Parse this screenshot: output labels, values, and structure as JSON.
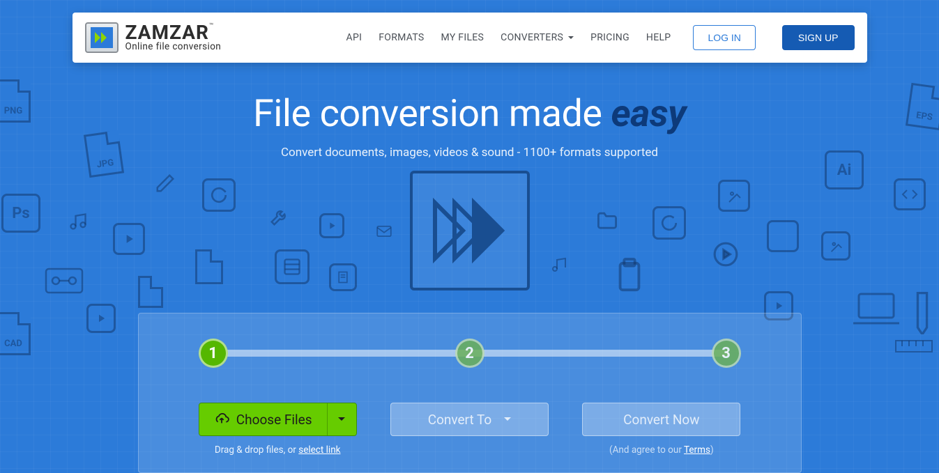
{
  "brand": {
    "name": "ZAMZAR",
    "trademark": "™",
    "tagline": "Online file conversion"
  },
  "nav": {
    "api": "API",
    "formats": "FORMATS",
    "myfiles": "MY FILES",
    "converters": "CONVERTERS",
    "pricing": "PRICING",
    "help": "HELP",
    "login": "LOG IN",
    "signup": "SIGN UP"
  },
  "hero": {
    "title_prefix": "File conversion made ",
    "title_emphasis": "easy",
    "subtitle": "Convert documents, images, videos & sound - 1100+ formats supported"
  },
  "steps": {
    "s1": "1",
    "s2": "2",
    "s3": "3"
  },
  "actions": {
    "choose": "Choose Files",
    "convert_to": "Convert To",
    "convert_now": "Convert Now"
  },
  "hints": {
    "drag_prefix": "Drag & drop files, or ",
    "select_link": "select link",
    "agree_prefix": "(And agree to our ",
    "terms": "Terms",
    "agree_suffix": ")"
  },
  "deco_labels": {
    "png": "PNG",
    "jpg": "JPG",
    "ps": "Ps",
    "cad": "CAD",
    "ai": "Ai",
    "eps": "EPS"
  },
  "colors": {
    "bg": "#2c7bd9",
    "accent_green": "#66cc00",
    "primary_blue": "#155bb3",
    "emphasis_dark": "#0d3a7a"
  }
}
